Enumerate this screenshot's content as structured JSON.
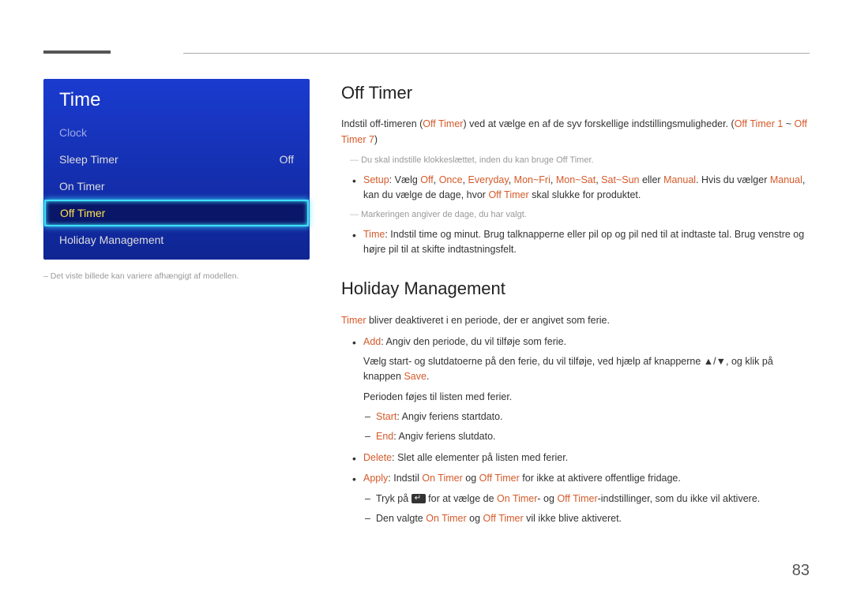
{
  "menu": {
    "title": "Time",
    "items": [
      {
        "label": "Clock",
        "value": ""
      },
      {
        "label": "Sleep Timer",
        "value": "Off"
      },
      {
        "label": "On Timer",
        "value": ""
      },
      {
        "label": "Off Timer",
        "value": ""
      },
      {
        "label": "Holiday Management",
        "value": ""
      }
    ],
    "caption_prefix": "–  ",
    "caption": "Det viste billede kan variere afhængigt af modellen."
  },
  "section1": {
    "heading": "Off Timer",
    "intro_a": "Indstil off-timeren (",
    "intro_b": "Off Timer",
    "intro_c": ") ved at vælge en af de syv forskellige indstillingsmuligheder. (",
    "intro_d": "Off Timer 1",
    "intro_e": " ~ ",
    "intro_f": "Off Timer 7",
    "intro_g": ")",
    "note1_a": "Du skal indstille klokkeslættet, inden du kan bruge ",
    "note1_b": "Off Timer",
    "note1_c": ".",
    "setup_label": "Setup",
    "setup_a": ": Vælg ",
    "setup_opts": [
      "Off",
      "Once",
      "Everyday",
      "Mon~Fri",
      "Mon~Sat",
      "Sat~Sun"
    ],
    "setup_or": " eller ",
    "setup_manual": "Manual",
    "setup_b": ". Hvis du vælger ",
    "setup_c": ", kan du vælge de dage, hvor ",
    "setup_d": "Off Timer",
    "setup_e": " skal slukke for produktet.",
    "note2": "Markeringen angiver de dage, du har valgt.",
    "time_label": "Time",
    "time_text": ": Indstil time og minut. Brug talknapperne eller pil op og pil ned til at indtaste tal. Brug venstre og højre pil til at skifte indtastningsfelt."
  },
  "section2": {
    "heading": "Holiday Management",
    "intro_a": "Timer",
    "intro_b": " bliver deaktiveret i en periode, der er angivet som ferie.",
    "add_label": "Add",
    "add_text": ": Angiv den periode, du vil tilføje som ferie.",
    "add_sub_a": "Vælg start- og slutdatoerne på den ferie, du vil tilføje, ved hjælp af knapperne ▲/▼, og klik på knappen ",
    "add_sub_save": "Save",
    "add_sub_b": ".",
    "add_sub_c": "Perioden føjes til listen med ferier.",
    "start_label": "Start",
    "start_text": ": Angiv feriens startdato.",
    "end_label": "End",
    "end_text": ": Angiv feriens slutdato.",
    "delete_label": "Delete",
    "delete_text": ": Slet alle elementer på listen med ferier.",
    "apply_label": "Apply",
    "apply_a": ": Indstil ",
    "apply_on": "On Timer",
    "apply_and": " og ",
    "apply_off": "Off Timer",
    "apply_b": " for ikke at aktivere offentlige fridage.",
    "apply_d1_a": "Tryk på ",
    "apply_d1_b": " for at vælge de ",
    "apply_d1_c": "- og ",
    "apply_d1_d": "-indstillinger, som du ikke vil aktivere.",
    "apply_d2_a": "Den valgte ",
    "apply_d2_b": " vil ikke blive aktiveret."
  },
  "page_number": "83"
}
